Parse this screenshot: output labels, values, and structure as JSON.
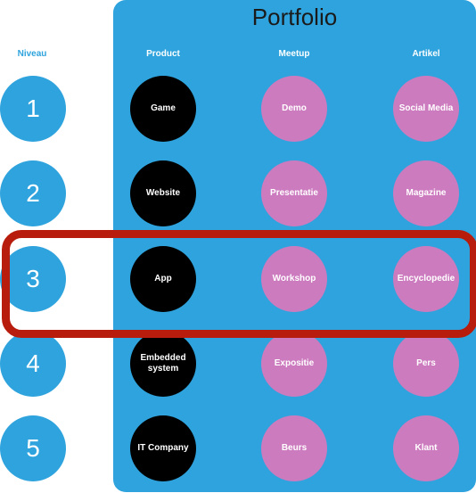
{
  "title": "Portfolio",
  "headers": {
    "level": "Niveau",
    "product": "Product",
    "meetup": "Meetup",
    "artikel": "Artikel"
  },
  "rows": [
    {
      "level": "1",
      "product": "Game",
      "meetup": "Demo",
      "artikel": "Social Media"
    },
    {
      "level": "2",
      "product": "Website",
      "meetup": "Presentatie",
      "artikel": "Magazine"
    },
    {
      "level": "3",
      "product": "App",
      "meetup": "Workshop",
      "artikel": "Encyclopedie"
    },
    {
      "level": "4",
      "product": "Embedded system",
      "meetup": "Expositie",
      "artikel": "Pers"
    },
    {
      "level": "5",
      "product": "IT Company",
      "meetup": "Beurs",
      "artikel": "Klant"
    }
  ],
  "highlighted_row": "3",
  "colors": {
    "panel": "#2ea3dd",
    "product_circle": "#000000",
    "meetup_artikel_circle": "#cd7bbf",
    "highlight_border": "#b81c0c"
  }
}
